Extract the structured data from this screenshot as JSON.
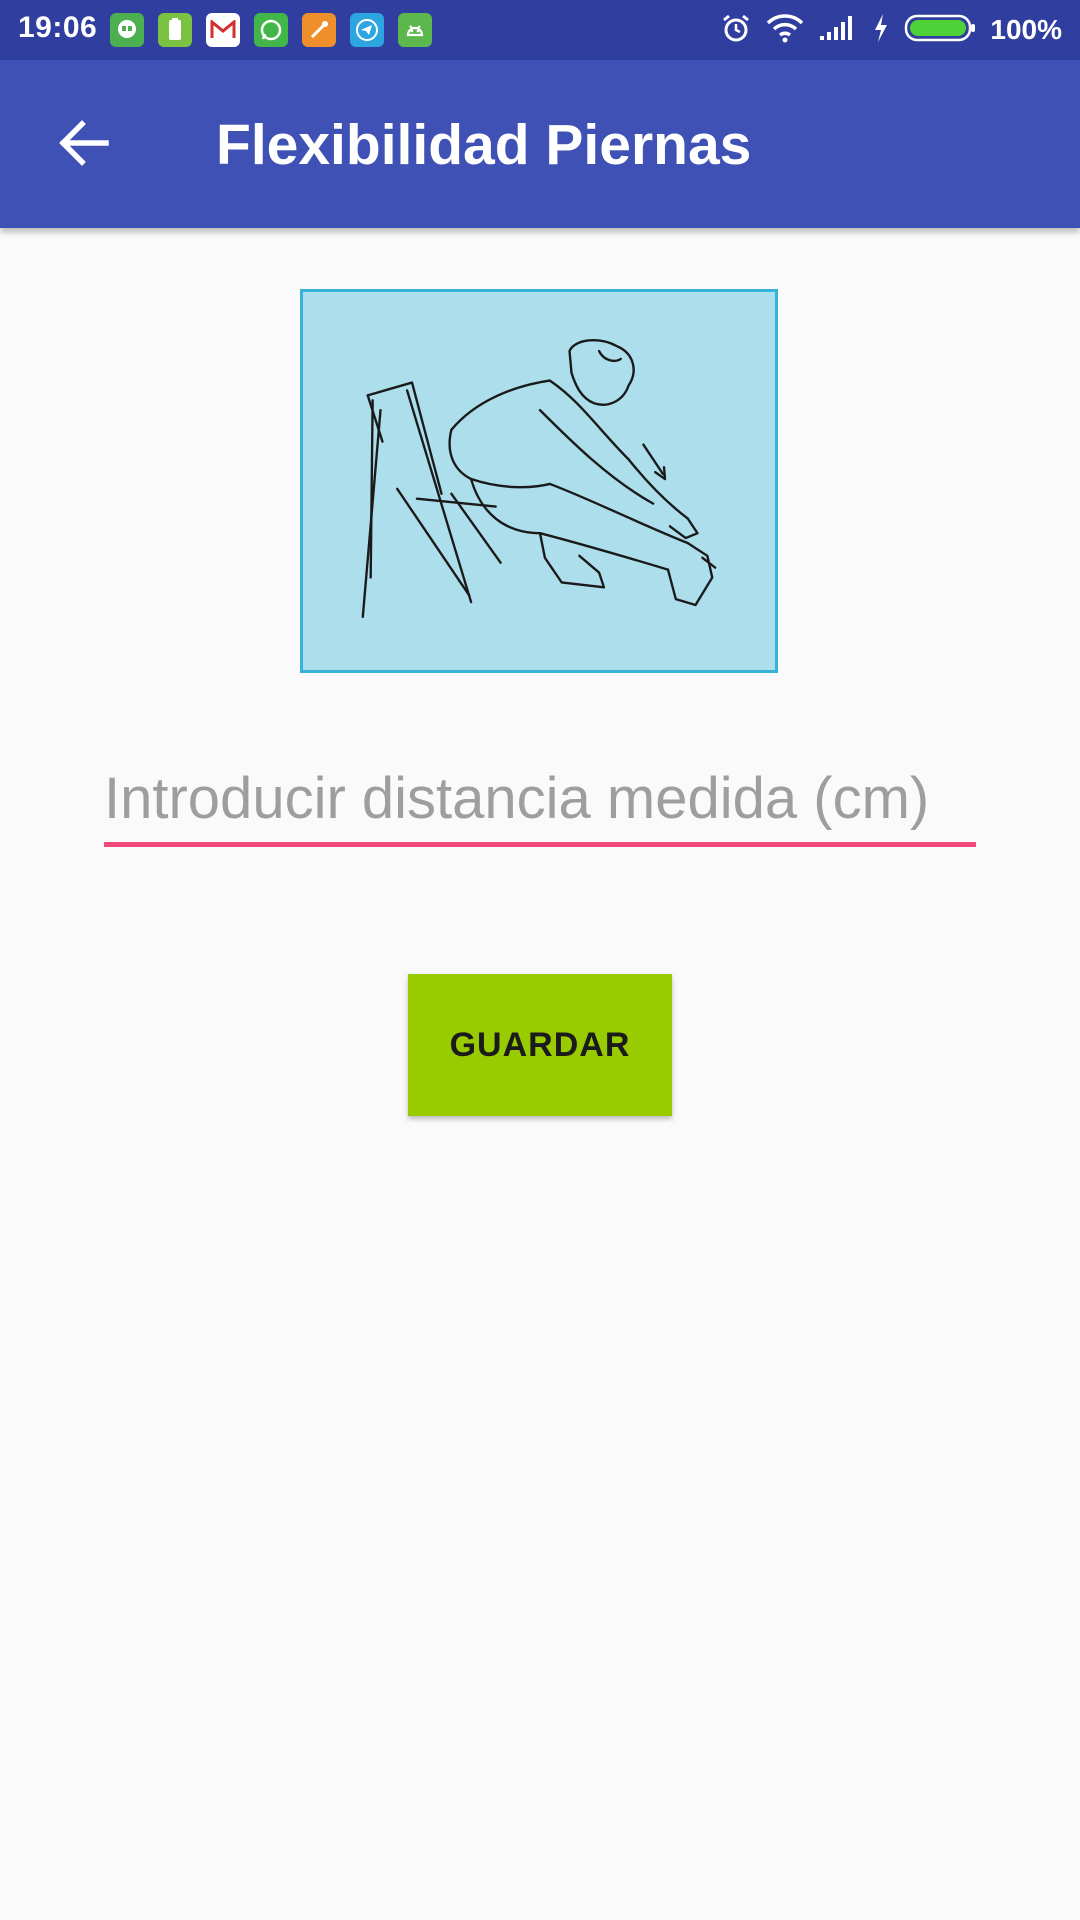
{
  "status_bar": {
    "time": "19:06",
    "notification_icons": [
      "hangouts-icon",
      "battery-app-icon",
      "gmail-icon",
      "whatsapp-icon",
      "tool-app-icon",
      "telegram-icon",
      "android-app-icon"
    ],
    "system_icons": [
      "alarm-icon",
      "wifi-icon",
      "signal-icon",
      "charging-icon",
      "battery-icon"
    ],
    "battery_percent": "100%"
  },
  "app_bar": {
    "title": "Flexibilidad Piernas",
    "back_icon": "arrow-left-icon"
  },
  "exercise_image": {
    "subject": "seated leg stretch illustration"
  },
  "distance_input": {
    "placeholder": "Introducir distancia medida (cm)",
    "value": ""
  },
  "save_button": {
    "label": "GUARDAR"
  },
  "colors": {
    "status_bar": "#303f9f",
    "app_bar": "#3f51b5",
    "background": "#fafafa",
    "image_background": "#acdeeb",
    "image_border": "#36b3d9",
    "input_underline": "#f2487a",
    "button": "#99cc00"
  }
}
